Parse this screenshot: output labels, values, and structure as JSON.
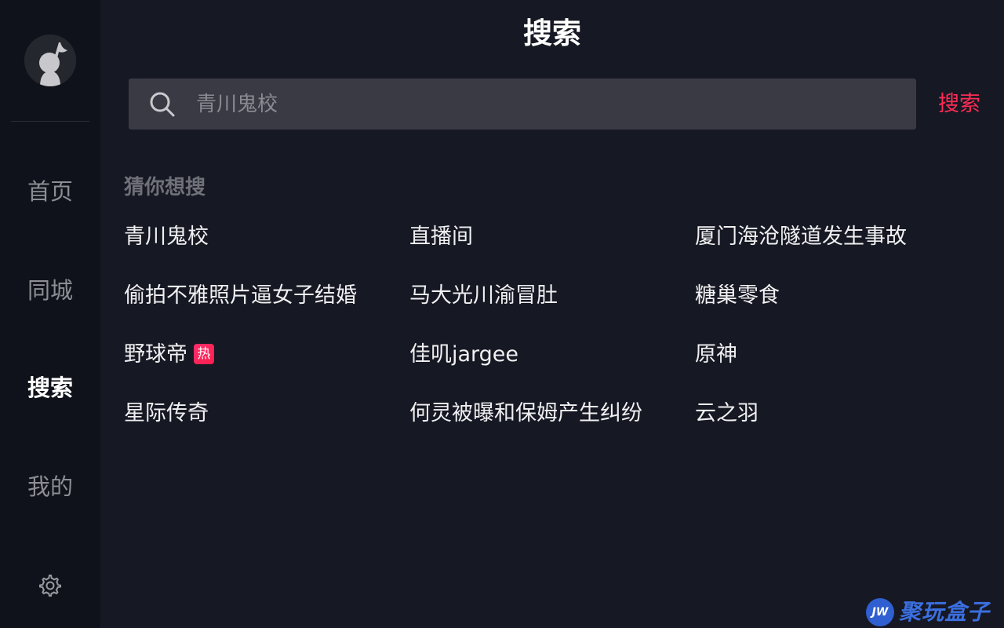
{
  "sidebar": {
    "nav": [
      {
        "label": "首页",
        "active": false
      },
      {
        "label": "同城",
        "active": false
      },
      {
        "label": "搜索",
        "active": true
      },
      {
        "label": "我的",
        "active": false
      }
    ],
    "settings_icon": "gear-icon"
  },
  "header": {
    "title": "搜索"
  },
  "search": {
    "placeholder": "青川鬼校",
    "button_label": "搜索",
    "icon": "search-icon"
  },
  "suggestions": {
    "label": "猜你想搜",
    "items": [
      {
        "text": "青川鬼校"
      },
      {
        "text": "直播间"
      },
      {
        "text": "厦门海沧隧道发生事故"
      },
      {
        "text": "偷拍不雅照片逼女子结婚"
      },
      {
        "text": "马大光川渝冒肚"
      },
      {
        "text": "糖巢零食"
      },
      {
        "text": "野球帝",
        "badge": "热"
      },
      {
        "text": "佳叽jargee"
      },
      {
        "text": "原神"
      },
      {
        "text": "星际传奇"
      },
      {
        "text": "何灵被曝和保姆产生纠纷"
      },
      {
        "text": "云之羽"
      }
    ]
  },
  "watermark": {
    "badge": "JW",
    "text": "聚玩盒子"
  },
  "colors": {
    "background": "#161823",
    "sidebar": "#10121b",
    "accent": "#fe2c55",
    "search_box": "#393a44"
  }
}
